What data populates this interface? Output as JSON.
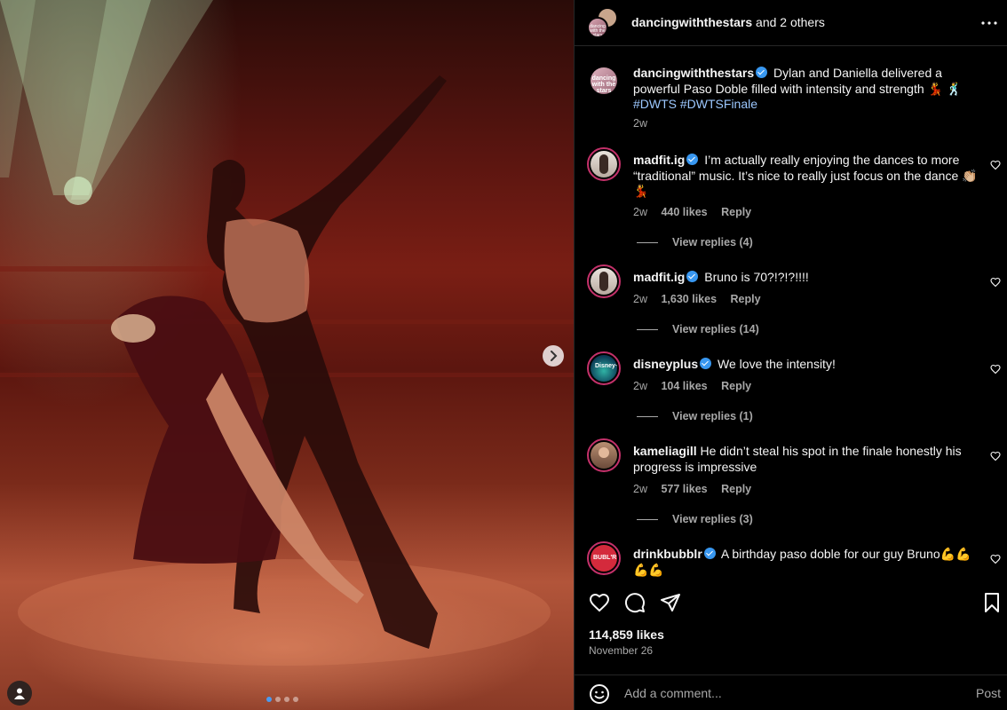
{
  "header": {
    "username": "dancingwiththestars",
    "and_others": "and 2 others"
  },
  "caption": {
    "username": "dancingwiththestars",
    "text": "Dylan and Daniella delivered a powerful Paso Doble filled with intensity and strength 💃 🕺",
    "hashtags": "#DWTS #DWTSFinale",
    "time": "2w"
  },
  "comments": [
    {
      "username": "madfit.ig",
      "verified": true,
      "text": "I’m actually really enjoying the dances to more “traditional” music. It’s nice to really just focus on the dance 👏🏼💃",
      "time": "2w",
      "likes": "440 likes",
      "reply": "Reply",
      "view_replies": "View replies (4)"
    },
    {
      "username": "madfit.ig",
      "verified": true,
      "text": "Bruno is 70?!?!?!!!!",
      "time": "2w",
      "likes": "1,630 likes",
      "reply": "Reply",
      "view_replies": "View replies (14)"
    },
    {
      "username": "disneyplus",
      "verified": true,
      "text": "We love the intensity!",
      "time": "2w",
      "likes": "104 likes",
      "reply": "Reply",
      "view_replies": "View replies (1)"
    },
    {
      "username": "kameliagill",
      "verified": false,
      "text": "He didn’t steal his spot in the finale honestly his progress is impressive",
      "time": "2w",
      "likes": "577 likes",
      "reply": "Reply",
      "view_replies": "View replies (3)"
    },
    {
      "username": "drinkbubblr",
      "verified": true,
      "text": "A birthday paso doble for our guy Bruno💪💪💪💪",
      "avatar_text": "BUBL'R"
    }
  ],
  "post": {
    "likes": "114,859 likes",
    "date": "November 26"
  },
  "composer": {
    "placeholder": "Add a comment...",
    "post_label": "Post"
  },
  "avatar_logo_text": "dancing with the stars",
  "carousel": {
    "slides": 4,
    "active": 0
  },
  "colors": {
    "background": "#000000",
    "text": "#f5f5f5",
    "secondary": "#a8a8a8",
    "verified": "#3897f0",
    "hashtag": "#9cc8ff",
    "story_ring": "#c4316a"
  },
  "icons": {
    "more": "more-horizontal-icon",
    "heart": "heart-icon",
    "comment": "comment-icon",
    "share": "share-icon",
    "save": "bookmark-icon",
    "emoji": "emoji-icon",
    "next": "chevron-right-icon",
    "tag": "user-tag-icon"
  }
}
